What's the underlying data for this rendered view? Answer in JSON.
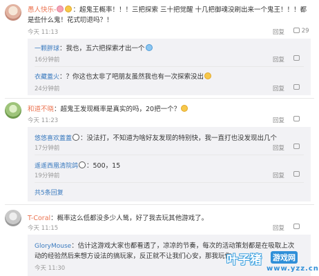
{
  "comments": [
    {
      "user": "愚人快乐-",
      "text": "：超鬼王概率！！！三把探索 三十把觉醒 十几把御魂没刷出来一个鬼王！！！都是些什么鬼！花式叨退吗？！",
      "line1": "：超鬼王概率！！！三把探索 三十把觉醒 十几把御魂没刷出来一个鬼王！！！都",
      "line2": "是些什么鬼！花式叨退吗？！",
      "time": "今天 11:13",
      "reply": "回复",
      "likes": "29",
      "replies": [
        {
          "user": "一颗胖球",
          "text": "：我也，五六把探索才出一个",
          "time": "16分钟前",
          "reply": "回复",
          "likes": ""
        },
        {
          "user": "衣藏蓋火",
          "text": "：？你这也太非了吧朋友虽然我也有一次探索没出",
          "time": "24分钟前",
          "reply": "回复",
          "likes": ""
        }
      ]
    },
    {
      "user": "和道不晓",
      "text": "：超鬼王发现概率是真实的吗，20把一个？",
      "time": "今天 11:23",
      "reply": "回复",
      "likes": "",
      "replies": [
        {
          "user": "悠悠喜欢蓋蓋",
          "text": "：没法打，不知道为啥好友发现的特别快，我一直打也没发现出几个",
          "time": "17分钟前",
          "reply": "回复",
          "likes": ""
        },
        {
          "user": "遥遥西凰清院鸽",
          "text": "：500，15",
          "time": "19分钟前",
          "reply": "回复",
          "likes": ""
        }
      ],
      "more": "共5条回复"
    },
    {
      "user": "T-Coral",
      "text": "：概率这么低都没多少人鸶，好了我去玩其他游戏了。",
      "time": "今天 11:15",
      "reply": "回复",
      "likes": "",
      "replies": [
        {
          "user": "GloryMouse",
          "line1": "：估计这游戏大家也都看透了，凉凉的节奏，每次的活动策划都是在吸取上次",
          "line2": "动的经验然后来想方设法的搞玩家，反正就不让我们心安，那我玩你",
          "time": "今天 11:30",
          "reply": "回复",
          "likes": ""
        }
      ]
    }
  ],
  "watermark": {
    "main": "叶子猪",
    "badge": "游戏网",
    "url": "www.yzz.cn"
  }
}
